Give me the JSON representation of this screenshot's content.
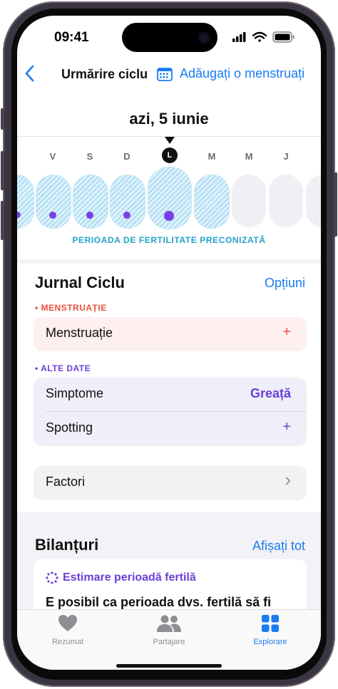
{
  "status_bar": {
    "time": "09:41"
  },
  "nav": {
    "back_icon": "chevron-left-icon",
    "title": "Urmărire ciclu",
    "add_label": "Adăugați o menstruați",
    "add_icon": "calendar-icon"
  },
  "date_header": "azi, 5 iunie",
  "week": {
    "days": [
      "V",
      "S",
      "D",
      "L",
      "M",
      "M",
      "J"
    ],
    "today_index": 3,
    "today_letter": "L",
    "fertile_window_label": "PERIOADA DE FERTILITATE PRECONIZATĂ"
  },
  "cycle_log": {
    "title": "Jurnal Ciclu",
    "options_label": "Opțiuni",
    "menstruation_category": "• MENSTRUAȚIE",
    "menstruation_row": {
      "label": "Menstruație",
      "action": "+"
    },
    "other_category": "• ALTE DATE",
    "symptoms_row": {
      "label": "Simptome",
      "value": "Greață"
    },
    "spotting_row": {
      "label": "Spotting",
      "action": "+"
    },
    "factors_row": {
      "label": "Factori",
      "chevron": "›"
    }
  },
  "highlights": {
    "title": "Bilanțuri",
    "show_all_label": "Afișați tot",
    "card_title": "Estimare perioadă fertilă",
    "card_body": "E posibil ca perioada dvs. fertilă să fi"
  },
  "tabbar": {
    "tabs": [
      {
        "label": "Rezumat",
        "icon": "heart-icon",
        "active": false
      },
      {
        "label": "Partajare",
        "icon": "people-icon",
        "active": false
      },
      {
        "label": "Explorare",
        "icon": "grid-icon",
        "active": true
      }
    ]
  },
  "colors": {
    "accent": "#1a7cf0",
    "menstruation": "#e8503c",
    "other_data": "#6b3fd8",
    "fertile": "#21a3c9"
  }
}
